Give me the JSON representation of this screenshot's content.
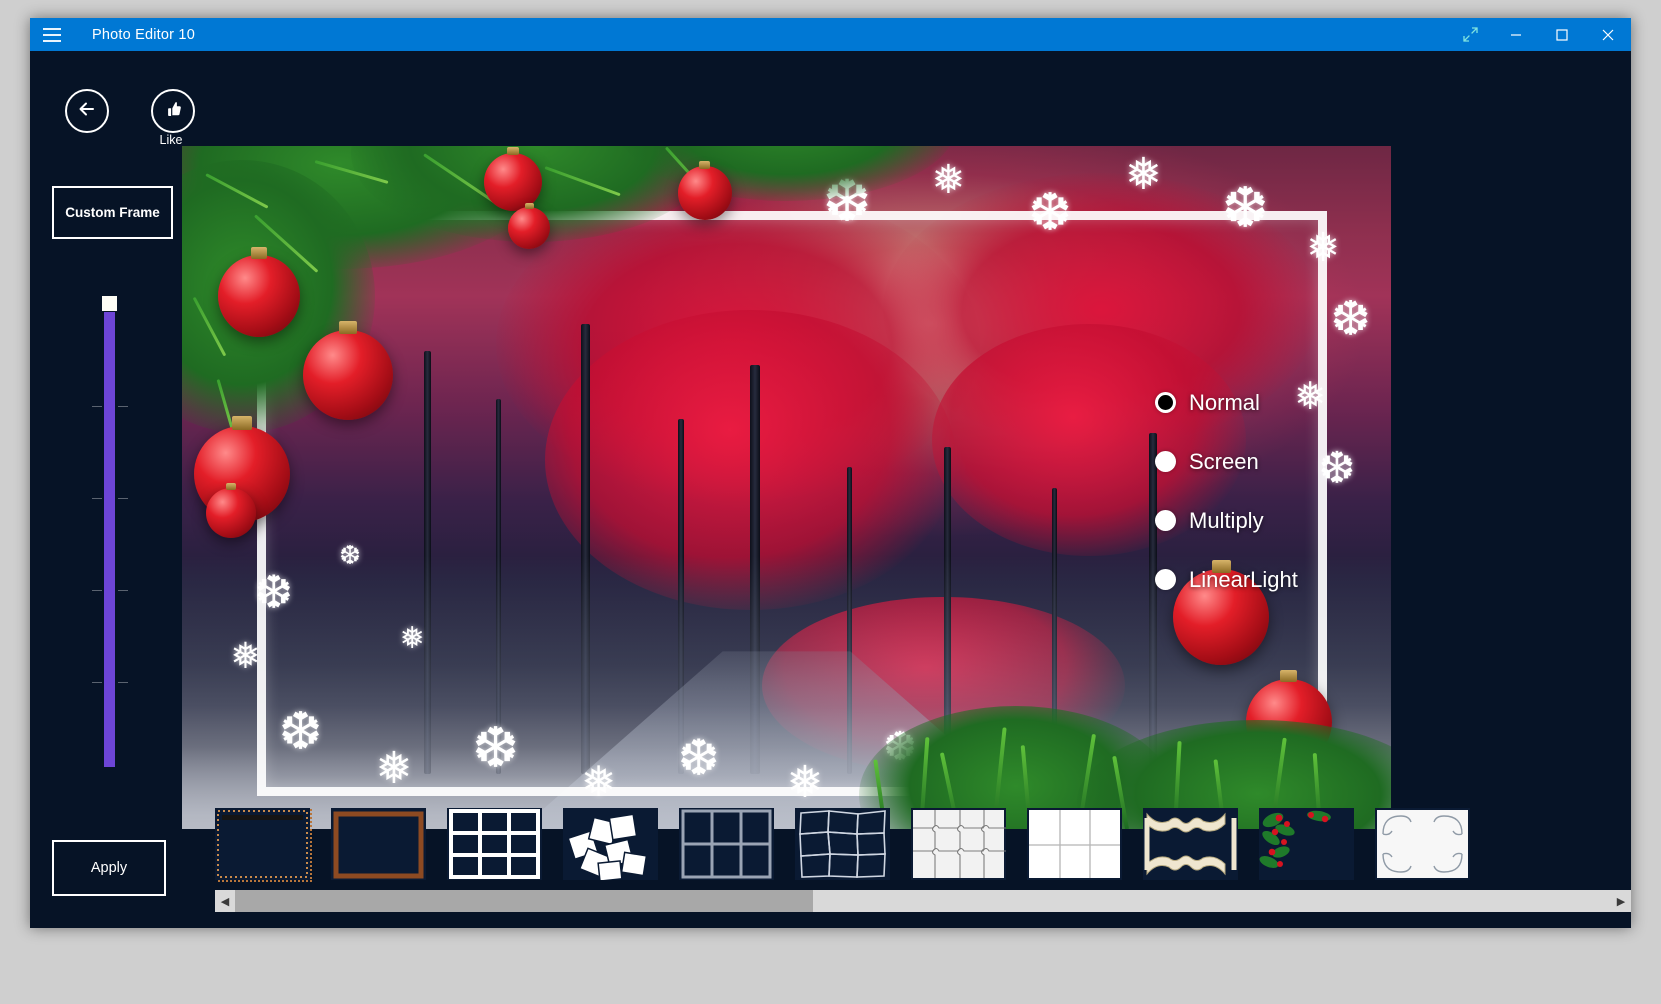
{
  "window": {
    "title": "Photo Editor 10",
    "menu_icon": "hamburger-icon",
    "controls": {
      "restore_expand": "expand-arrows-icon",
      "minimize": "minimize-icon",
      "maximize": "maximize-icon",
      "close": "close-icon"
    }
  },
  "toolbar": {
    "back_icon": "back-arrow-icon",
    "like_icon": "thumbs-up-icon",
    "like_label": "Like"
  },
  "sidebar": {
    "custom_frame_label": "Custom Frame",
    "apply_label": "Apply",
    "slider": {
      "name": "opacity-slider",
      "orientation": "vertical",
      "value_percent": 97,
      "tick_count": 4,
      "track_color": "#6d45d6",
      "thumb_color": "#fdfdf5"
    }
  },
  "blend_modes": {
    "selected": "Normal",
    "options": [
      {
        "label": "Normal",
        "selected": true
      },
      {
        "label": "Screen",
        "selected": false
      },
      {
        "label": "Multiply",
        "selected": false
      },
      {
        "label": "LinearLight",
        "selected": false
      }
    ]
  },
  "frames": {
    "selected_index": 0,
    "items": [
      {
        "name": "dotted-border-frame",
        "style": "dotted"
      },
      {
        "name": "wood-border-frame",
        "style": "wood"
      },
      {
        "name": "grid-six-frame",
        "style": "grid6"
      },
      {
        "name": "scattered-squares-frame",
        "style": "scatter"
      },
      {
        "name": "soft-grid-frame",
        "style": "softgrid"
      },
      {
        "name": "mosaic-tiles-frame",
        "style": "mosaic"
      },
      {
        "name": "puzzle-frame",
        "style": "puzzle"
      },
      {
        "name": "grid-white-frame",
        "style": "gridwhite"
      },
      {
        "name": "ornate-vintage-frame",
        "style": "ornate"
      },
      {
        "name": "holly-corner-frame",
        "style": "holly"
      },
      {
        "name": "floral-scroll-frame",
        "style": "floral"
      }
    ]
  },
  "scrollbar": {
    "left_arrow": "◀",
    "right_arrow": "▶",
    "thumb_position_percent": 0,
    "thumb_width_percent": 42
  },
  "colors": {
    "titlebar": "#0078d4",
    "app_background": "#061326",
    "accent_slider": "#6d45d6",
    "text": "#ffffff"
  }
}
